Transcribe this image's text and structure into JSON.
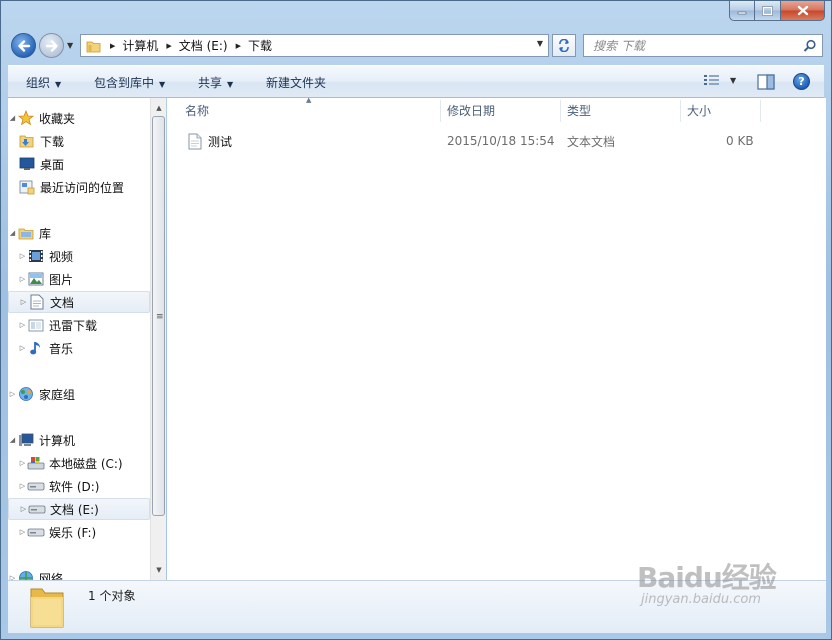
{
  "window": {
    "buttons": {
      "minimize": "minimize",
      "maximize": "maximize",
      "close": "close"
    }
  },
  "address": {
    "crumbs": [
      "计算机",
      "文档 (E:)",
      "下载"
    ]
  },
  "search": {
    "placeholder": "搜索 下载"
  },
  "toolbar": {
    "organize": "组织",
    "include_in_library": "包含到库中",
    "share": "共享",
    "new_folder": "新建文件夹"
  },
  "navpane": {
    "favorites": {
      "label": "收藏夹",
      "items": [
        "下载",
        "桌面",
        "最近访问的位置"
      ]
    },
    "libraries": {
      "label": "库",
      "items": [
        "视频",
        "图片",
        "文档",
        "迅雷下载",
        "音乐"
      ]
    },
    "homegroup": {
      "label": "家庭组"
    },
    "computer": {
      "label": "计算机",
      "items": [
        "本地磁盘 (C:)",
        "软件 (D:)",
        "文档 (E:)",
        "娱乐 (F:)"
      ]
    },
    "network": {
      "label": "网络"
    }
  },
  "columns": {
    "name": "名称",
    "modified": "修改日期",
    "type": "类型",
    "size": "大小"
  },
  "files": [
    {
      "name": "测试",
      "modified": "2015/10/18 15:54",
      "type": "文本文档",
      "size": "0 KB"
    }
  ],
  "details": {
    "count_text": "1 个对象"
  },
  "watermark": {
    "brand": "Baidu经验",
    "url": "jingyan.baidu.com"
  },
  "colors": {
    "accent": "#2a66b8",
    "selection": "#e6edf6",
    "frame": "#a9c7e6"
  }
}
